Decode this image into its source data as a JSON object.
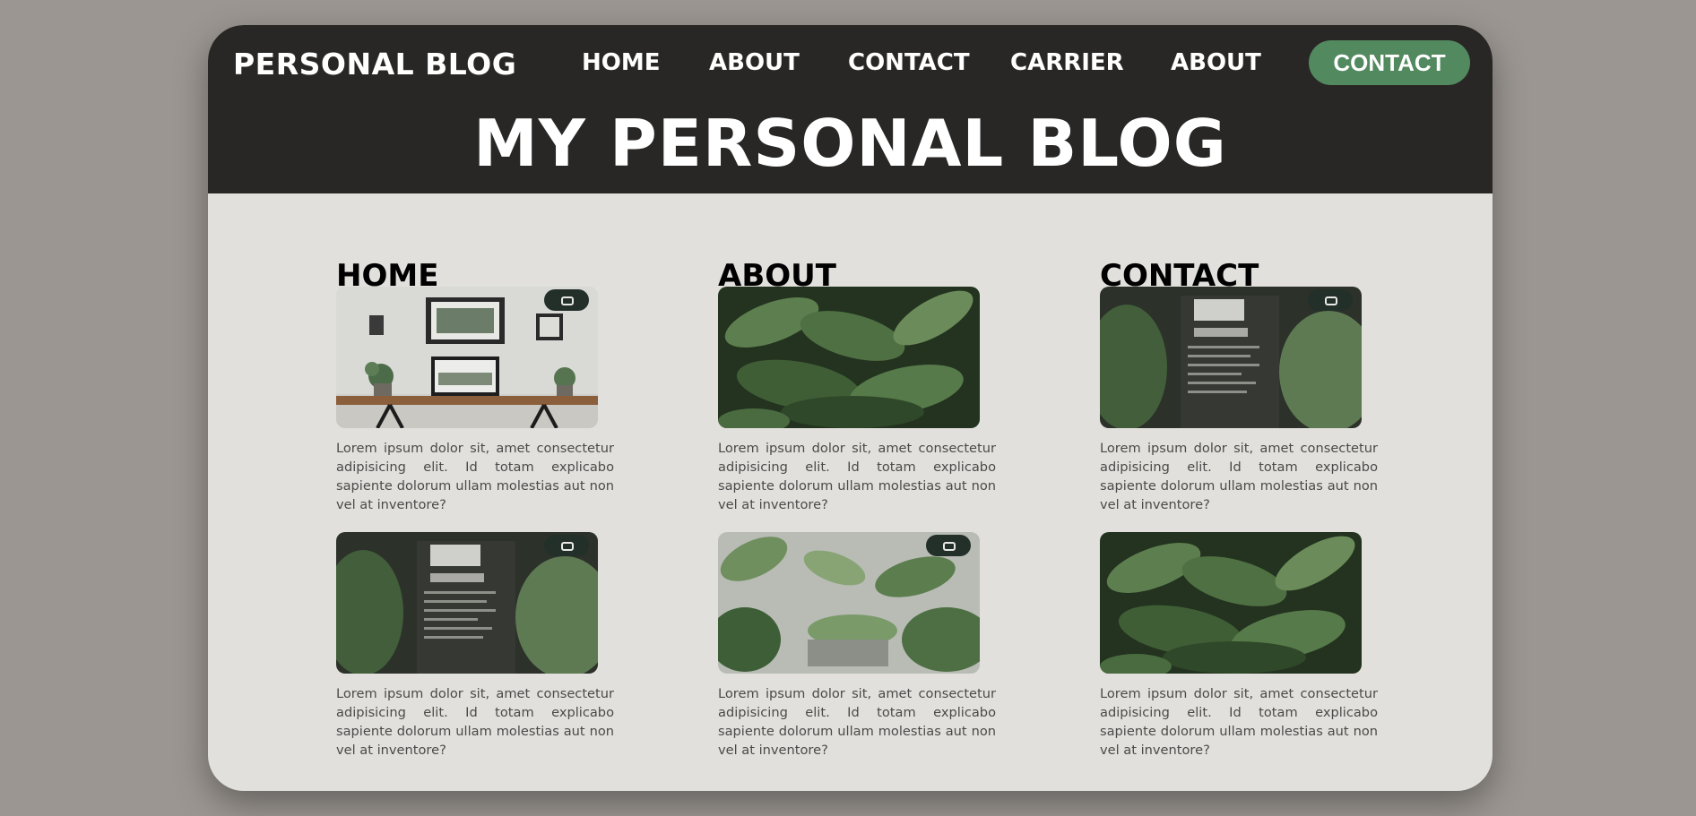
{
  "header": {
    "logo": "PERSONAL BLOG",
    "nav": [
      "HOME",
      "ABOUT",
      "CONTACT",
      "CARRIER",
      "ABOUT"
    ],
    "cta_label": "CONTACT",
    "hero_title": "MY PERSONAL BLOG"
  },
  "columns": [
    {
      "heading": "HOME"
    },
    {
      "heading": "ABOUT"
    },
    {
      "heading": "CONTACT"
    }
  ],
  "posts": [
    {
      "image": "desk-with-frames",
      "excerpt": "Lorem ipsum dolor sit, amet consectetur adipisicing elit. Id totam explicabo sapiente dolorum ullam molestias aut non vel at inventore?"
    },
    {
      "image": "leafy-plants",
      "excerpt": "Lorem ipsum dolor sit, amet consectetur adipisicing elit. Id totam explicabo sapiente dolorum ullam molestias aut non vel at inventore?"
    },
    {
      "image": "plant-wall-poster",
      "excerpt": "Lorem ipsum dolor sit, amet consectetur adipisicing elit. Id totam explicabo sapiente dolorum ullam molestias aut non vel at inventore?"
    },
    {
      "image": "plant-wall-poster",
      "excerpt": "Lorem ipsum dolor sit, amet consectetur adipisicing elit. Id totam explicabo sapiente dolorum ullam molestias aut non vel at inventore?"
    },
    {
      "image": "pale-leaves",
      "excerpt": "Lorem ipsum dolor sit, amet consectetur adipisicing elit. Id totam explicabo sapiente dolorum ullam molestias aut non vel at inventore?"
    },
    {
      "image": "leafy-plants",
      "excerpt": "Lorem ipsum dolor sit, amet consectetur adipisicing elit. Id totam explicabo sapiente dolorum ullam molestias aut non vel at inventore?"
    }
  ],
  "colors": {
    "page_bg": "#9b9691",
    "card_bg": "#e1e0dc",
    "header_bg": "#292725",
    "accent": "#53895f",
    "text": "#4a4a4a"
  }
}
